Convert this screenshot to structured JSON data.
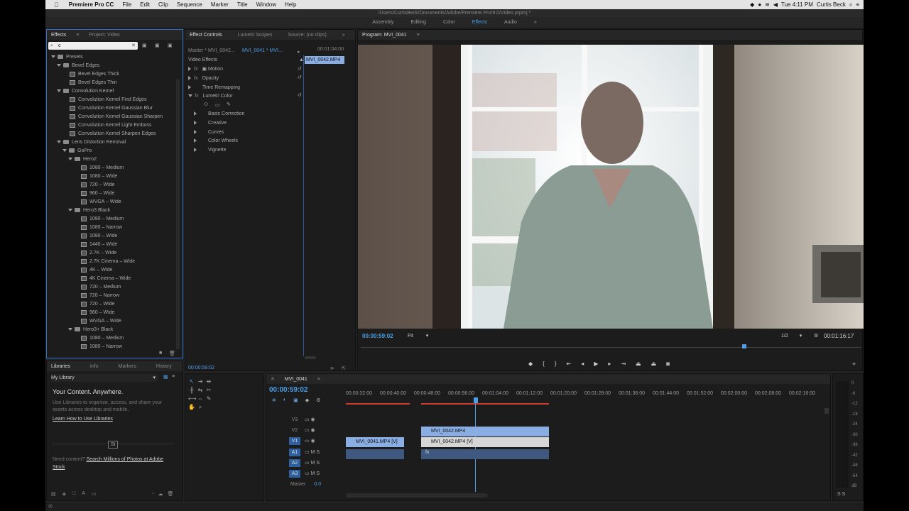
{
  "menubar": {
    "app": "Premiere Pro CC",
    "items": [
      "File",
      "Edit",
      "Clip",
      "Sequence",
      "Marker",
      "Title",
      "Window",
      "Help"
    ],
    "clock": "Tue 4:11 PM",
    "user": "Curtis Beck"
  },
  "window_title": "/Users/CurtisBeck/Documents/Adobe/Premiere Pro/9.0/Video.prproj *",
  "workspaces": [
    "Assembly",
    "Editing",
    "Color",
    "Effects",
    "Audio"
  ],
  "workspace_active": "Effects",
  "effects_panel": {
    "tab": "Effects",
    "tab2": "Project: Video",
    "search": "c",
    "tree": [
      {
        "label": "Presets",
        "lvl": 0,
        "kind": "bin"
      },
      {
        "label": "Bevel Edges",
        "lvl": 1,
        "kind": "bin"
      },
      {
        "label": "Bevel Edges Thick",
        "lvl": 2,
        "kind": "preset"
      },
      {
        "label": "Bevel Edges Thin",
        "lvl": 2,
        "kind": "preset"
      },
      {
        "label": "Convolution Kernel",
        "lvl": 1,
        "kind": "bin"
      },
      {
        "label": "Convolution Kernel Find Edges",
        "lvl": 2,
        "kind": "preset"
      },
      {
        "label": "Convolution Kernel Gaussian Blur",
        "lvl": 2,
        "kind": "preset"
      },
      {
        "label": "Convolution Kernel Gaussian Sharpen",
        "lvl": 2,
        "kind": "preset"
      },
      {
        "label": "Convolution Kernel Light Emboss",
        "lvl": 2,
        "kind": "preset"
      },
      {
        "label": "Convolution Kernel Sharpen Edges",
        "lvl": 2,
        "kind": "preset"
      },
      {
        "label": "Lens Distortion Removal",
        "lvl": 1,
        "kind": "bin"
      },
      {
        "label": "GoPro",
        "lvl": 2,
        "kind": "bin"
      },
      {
        "label": "Hero2",
        "lvl": 3,
        "kind": "bin"
      },
      {
        "label": "1080 – Medium",
        "lvl": 4,
        "kind": "preset"
      },
      {
        "label": "1080 – Wide",
        "lvl": 4,
        "kind": "preset"
      },
      {
        "label": "720 – Wide",
        "lvl": 4,
        "kind": "preset"
      },
      {
        "label": "960 – Wide",
        "lvl": 4,
        "kind": "preset"
      },
      {
        "label": "WVGA – Wide",
        "lvl": 4,
        "kind": "preset"
      },
      {
        "label": "Hero3 Black",
        "lvl": 3,
        "kind": "bin"
      },
      {
        "label": "1080 – Medium",
        "lvl": 4,
        "kind": "preset"
      },
      {
        "label": "1080 – Narrow",
        "lvl": 4,
        "kind": "preset"
      },
      {
        "label": "1080 – Wide",
        "lvl": 4,
        "kind": "preset"
      },
      {
        "label": "1440 – Wide",
        "lvl": 4,
        "kind": "preset"
      },
      {
        "label": "2.7K – Wide",
        "lvl": 4,
        "kind": "preset"
      },
      {
        "label": "2.7K Cinema – Wide",
        "lvl": 4,
        "kind": "preset"
      },
      {
        "label": "4K – Wide",
        "lvl": 4,
        "kind": "preset"
      },
      {
        "label": "4K Cinema – Wide",
        "lvl": 4,
        "kind": "preset"
      },
      {
        "label": "720 – Medium",
        "lvl": 4,
        "kind": "preset"
      },
      {
        "label": "720 – Narrow",
        "lvl": 4,
        "kind": "preset"
      },
      {
        "label": "720 – Wide",
        "lvl": 4,
        "kind": "preset"
      },
      {
        "label": "960 – Wide",
        "lvl": 4,
        "kind": "preset"
      },
      {
        "label": "WVGA – Wide",
        "lvl": 4,
        "kind": "preset"
      },
      {
        "label": "Hero3+ Black",
        "lvl": 3,
        "kind": "bin"
      },
      {
        "label": "1080 – Medium",
        "lvl": 4,
        "kind": "preset"
      },
      {
        "label": "1080 – Narrow",
        "lvl": 4,
        "kind": "preset"
      }
    ]
  },
  "effect_controls": {
    "tabs": [
      "Effect Controls",
      "Lumetri Scopes",
      "Source: (no clips)"
    ],
    "master": "Master * MVI_0042...",
    "clip": "MVI_0041 * MVI...",
    "tc": "00:01:04:00",
    "clip_label": "MVI_0042.MP4",
    "section": "Video Effects",
    "effects": [
      "Motion",
      "Opacity",
      "Time Remapping",
      "Lumetri Color"
    ],
    "lumetri": [
      "Basic Correction",
      "Creative",
      "Curves",
      "Color Wheels",
      "Vignette"
    ],
    "timecode": "00:00:59:02"
  },
  "program": {
    "title": "Program: MVI_0041",
    "timecode": "00:00:59:02",
    "fit": "Fit",
    "resolution": "1/2",
    "duration": "00:01:16:17"
  },
  "libraries": {
    "tabs": [
      "Libraries",
      "Info",
      "Markers",
      "History"
    ],
    "library": "My Library",
    "heading": "Your Content. Anywhere.",
    "body": "Use Libraries to organize, access, and share your assets across desktop and mobile.",
    "link": "Learn How to Use Libraries",
    "need": "Need content?",
    "stock": "Search Millions of Photos at Adobe Stock",
    "badge": "St"
  },
  "timeline": {
    "tab": "MVI_0041",
    "timecode": "00:00:59:02",
    "ruler": [
      "00:00:32:00",
      "00:00:40:00",
      "00:00:48:00",
      "00:00:56:00",
      "00:01:04:00",
      "00:01:12:00",
      "00:01:20:00",
      "00:01:28:00",
      "00:01:36:00",
      "00:01:44:00",
      "00:01:52:00",
      "00:02:00:00",
      "00:02:08:00",
      "00:02:16:00"
    ],
    "tracks": [
      "V3",
      "V2",
      "V1",
      "A1",
      "A2",
      "A3"
    ],
    "master": "Master",
    "master_val": "0.0",
    "clips": {
      "v2": "MVI_0042.MP4",
      "v1a": "MVI_0041.MP4 [V]",
      "v1b": "MVI_0042.MP4 [V]",
      "fx": "fx"
    },
    "meter": [
      "0",
      "-6",
      "-12",
      "-18",
      "-24",
      "-30",
      "-36",
      "-42",
      "-48",
      "-54",
      "dB"
    ],
    "solo": "S S"
  },
  "colors": {
    "accent": "#4b9ee8",
    "bg": "#232323",
    "clip_video": "#8aaee3",
    "clip_audio": "#3e5880"
  }
}
